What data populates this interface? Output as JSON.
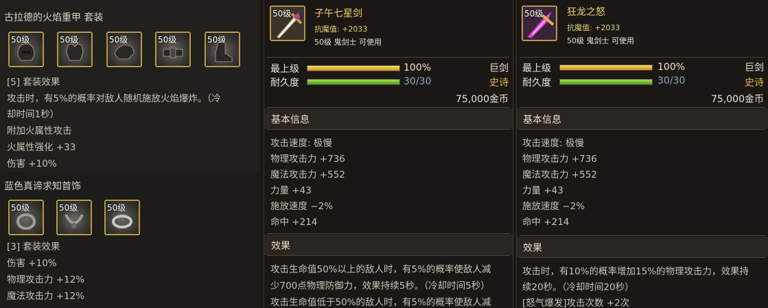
{
  "left": {
    "set1": {
      "title": "古拉德的火焰重甲  套装",
      "items": [
        {
          "level": "50级",
          "icon": "helmet-icon"
        },
        {
          "level": "50级",
          "icon": "chest-armor-icon"
        },
        {
          "level": "50级",
          "icon": "shoulder-armor-icon"
        },
        {
          "level": "50级",
          "icon": "belt-icon"
        },
        {
          "level": "50级",
          "icon": "boots-icon"
        }
      ],
      "effect_header": "[5] 套装效果",
      "effects": [
        "攻击时，有5%的概率对敌人随机施放火焰爆炸。（冷",
        "却时间1秒）",
        "附加火属性攻击",
        "火属性强化 +33",
        "伤害 +10%"
      ]
    },
    "set2": {
      "title": "蓝色真谛求知首饰",
      "items": [
        {
          "level": "50级",
          "icon": "bracelet-icon"
        },
        {
          "level": "50级",
          "icon": "necklace-icon"
        },
        {
          "level": "50级",
          "icon": "ring-icon"
        }
      ],
      "effect_header": "[3] 套装效果",
      "effects": [
        "伤害 +10%",
        "物理攻击力 +12%",
        "魔法攻击力 +12%"
      ]
    }
  },
  "items": [
    {
      "level": "50级",
      "name": "子午七星剑",
      "anti_magic": "抗魔值: +2033",
      "requirement": "50级 鬼剑士 可使用",
      "grade_label": "最上级",
      "grade_pct": "100%",
      "grade_value": 1.0,
      "durability_label": "耐久度",
      "durability": "30/30",
      "durability_value": 1.0,
      "type": "巨剑",
      "rarity": "史诗",
      "price": "75,000金币",
      "basic_header": "基本信息",
      "stats": [
        "攻击速度: 极慢",
        "物理攻击力 +736",
        "魔法攻击力 +552",
        "力量 +43",
        "施放速度 −2%",
        "命中 +214"
      ],
      "effect_header": "效果",
      "effects": [
        "攻击生命值50%以上的敌人时，有5%的概率使敌人减",
        "少700点物理防御力，效果持续5秒。（冷却时间5秒）",
        "攻击生命值低于50%的敌人时，有5%的概率使敌人减"
      ],
      "accent": "#f2d26b"
    },
    {
      "level": "50级",
      "name": "狂龙之怒",
      "anti_magic": "抗魔值: +2033",
      "requirement": "50级 鬼剑士 可使用",
      "grade_label": "最上级",
      "grade_pct": "100%",
      "grade_value": 1.0,
      "durability_label": "耐久度",
      "durability": "30/30",
      "durability_value": 1.0,
      "type": "巨剑",
      "rarity": "史诗",
      "price": "75,000金币",
      "basic_header": "基本信息",
      "stats": [
        "攻击速度: 极慢",
        "物理攻击力 +736",
        "魔法攻击力 +552",
        "力量 +43",
        "施放速度 −2%",
        "命中 +214"
      ],
      "effect_header": "效果",
      "effects": [
        "攻击时，有10%的概率增加15%的物理攻击力，效果持",
        "续20秒。（冷却时间20秒）",
        "[怒气爆发]攻击次数 +2次"
      ],
      "accent": "#f2d26b"
    }
  ]
}
